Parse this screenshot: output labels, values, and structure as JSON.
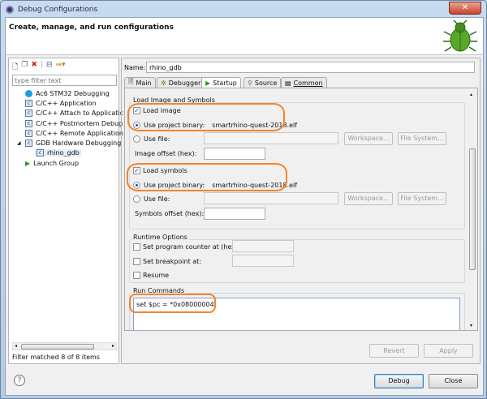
{
  "window": {
    "title": "Debug Configurations",
    "header": "Create, manage, and run configurations"
  },
  "sidebar": {
    "filter_placeholder": "type filter text",
    "items": [
      {
        "label": "Ac6 STM32 Debugging",
        "icon": "ac6-icon"
      },
      {
        "label": "C/C++ Application",
        "icon": "c-config-icon"
      },
      {
        "label": "C/C++ Attach to Applicatic",
        "icon": "c-config-icon"
      },
      {
        "label": "C/C++ Postmortem Debug",
        "icon": "c-config-icon"
      },
      {
        "label": "C/C++ Remote Application",
        "icon": "c-config-icon"
      },
      {
        "label": "GDB Hardware Debugging",
        "icon": "c-config-icon",
        "expanded": true
      },
      {
        "label": "rhino_gdb",
        "icon": "c-config-icon",
        "selected": true
      },
      {
        "label": "Launch Group",
        "icon": "launch-icon"
      }
    ],
    "status": "Filter matched 8 of 8 items"
  },
  "config": {
    "name_label": "Name:",
    "name_value": "rhino_gdb",
    "tabs": [
      "Main",
      "Debugger",
      "Startup",
      "Source",
      "Common"
    ],
    "active_tab": "Startup",
    "load_group": {
      "title": "Load Image and Symbols",
      "load_image": "Load image",
      "load_image_checked": true,
      "use_project_binary": "Use project binary:",
      "image_binary": "smartrhino-quest-2018.elf",
      "use_file": "Use file:",
      "workspace": "Workspace...",
      "file_system": "File System...",
      "image_offset": "Image offset (hex):",
      "load_symbols": "Load symbols",
      "load_symbols_checked": true,
      "symbols_binary": "smartrhino-quest-2018.elf",
      "symbols_offset": "Symbols offset (hex):"
    },
    "runtime": {
      "title": "Runtime Options",
      "set_pc": "Set program counter at (hex):",
      "set_bp": "Set breakpoint at:",
      "resume": "Resume"
    },
    "run_commands": {
      "title": "Run Commands",
      "value": "set $pc = *0x08000004"
    },
    "revert": "Revert",
    "apply": "Apply"
  },
  "footer": {
    "debug": "Debug",
    "close": "Close"
  },
  "colors": {
    "highlight": "#f5842a"
  }
}
